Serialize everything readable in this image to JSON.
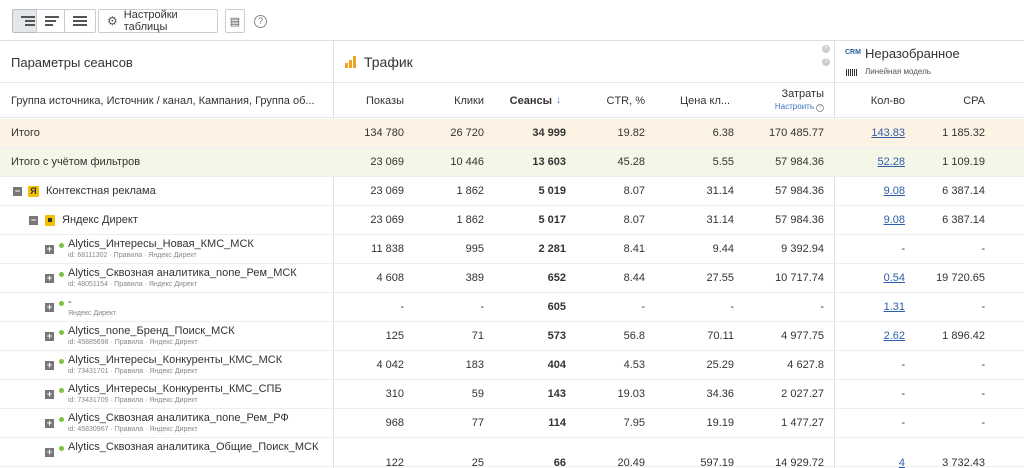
{
  "toolbar": {
    "settings_label": "Настройки таблицы"
  },
  "sections": {
    "params": "Параметры сеансов",
    "traffic": "Трафик",
    "unparsed": "Неразобранное",
    "unparsed_badge": "CRM",
    "model": "Линейная модель"
  },
  "columns": {
    "group": "Группа источника, Источник / канал, Кампания, Группа об...",
    "impressions": "Показы",
    "clicks": "Клики",
    "sessions": "Сеансы",
    "sort_arrow": "↓",
    "ctr": "CTR, %",
    "cpc": "Цена кл...",
    "cost": "Затраты",
    "setup": "Настроить",
    "qty": "Кол-во",
    "cpa": "CPA"
  },
  "rows": [
    {
      "label": "Итого",
      "impressions": "134 780",
      "clicks": "26 720",
      "sessions": "34 999",
      "ctr": "19.82",
      "cpc": "6.38",
      "cost": "170 485.77",
      "qty": "143.83",
      "cpa": "1 185.32"
    },
    {
      "label": "Итого с учётом фильтров",
      "impressions": "23 069",
      "clicks": "10 446",
      "sessions": "13 603",
      "ctr": "45.28",
      "cpc": "5.55",
      "cost": "57 984.36",
      "qty": "52.28",
      "cpa": "1 109.19"
    },
    {
      "label": "Контекстная реклама",
      "impressions": "23 069",
      "clicks": "1 862",
      "sessions": "5 019",
      "ctr": "8.07",
      "cpc": "31.14",
      "cost": "57 984.36",
      "qty": "9.08",
      "cpa": "6 387.14"
    },
    {
      "label": "Яндекс Директ",
      "impressions": "23 069",
      "clicks": "1 862",
      "sessions": "5 017",
      "ctr": "8.07",
      "cpc": "31.14",
      "cost": "57 984.36",
      "qty": "9.08",
      "cpa": "6 387.14"
    },
    {
      "label": "Alytics_Интересы_Новая_КМС_МСК",
      "sub": "id: 68111302 · Правила · Яндекс Директ",
      "impressions": "11 838",
      "clicks": "995",
      "sessions": "2 281",
      "ctr": "8.41",
      "cpc": "9.44",
      "cost": "9 392.94",
      "qty": "-",
      "cpa": "-"
    },
    {
      "label": "Alytics_Сквозная аналитика_none_Рем_МСК",
      "sub": "id: 48051154 · Правила · Яндекс Директ",
      "impressions": "4 608",
      "clicks": "389",
      "sessions": "652",
      "ctr": "8.44",
      "cpc": "27.55",
      "cost": "10 717.74",
      "qty": "0.54",
      "cpa": "19 720.65"
    },
    {
      "label": "-",
      "sub": "Яндекс Директ",
      "impressions": "-",
      "clicks": "-",
      "sessions": "605",
      "ctr": "-",
      "cpc": "-",
      "cost": "-",
      "qty": "1.31",
      "cpa": "-"
    },
    {
      "label": "Alytics_none_Бренд_Поиск_МСК",
      "sub": "id: 45885698 · Правила · Яндекс Директ",
      "impressions": "125",
      "clicks": "71",
      "sessions": "573",
      "ctr": "56.8",
      "cpc": "70.11",
      "cost": "4 977.75",
      "qty": "2.62",
      "cpa": "1 896.42"
    },
    {
      "label": "Alytics_Интересы_Конкуренты_КМС_МСК",
      "sub": "id: 73431701 · Правила · Яндекс Директ",
      "impressions": "4 042",
      "clicks": "183",
      "sessions": "404",
      "ctr": "4.53",
      "cpc": "25.29",
      "cost": "4 627.8",
      "qty": "-",
      "cpa": "-"
    },
    {
      "label": "Alytics_Интересы_Конкуренты_КМС_СПБ",
      "sub": "id: 73431705 · Правила · Яндекс Директ",
      "impressions": "310",
      "clicks": "59",
      "sessions": "143",
      "ctr": "19.03",
      "cpc": "34.36",
      "cost": "2 027.27",
      "qty": "-",
      "cpa": "-"
    },
    {
      "label": "Alytics_Сквозная аналитика_none_Рем_РФ",
      "sub": "id: 45830967 · Правила · Яндекс Директ",
      "impressions": "968",
      "clicks": "77",
      "sessions": "114",
      "ctr": "7.95",
      "cpc": "19.19",
      "cost": "1 477.27",
      "qty": "-",
      "cpa": "-"
    },
    {
      "label": "Alytics_Сквозная аналитика_Общие_Поиск_МСК",
      "impressions": "122",
      "clicks": "25",
      "sessions": "66",
      "ctr": "20.49",
      "cpc": "597.19",
      "cost": "14 929.72",
      "qty": "4",
      "cpa": "3 732.43"
    }
  ]
}
